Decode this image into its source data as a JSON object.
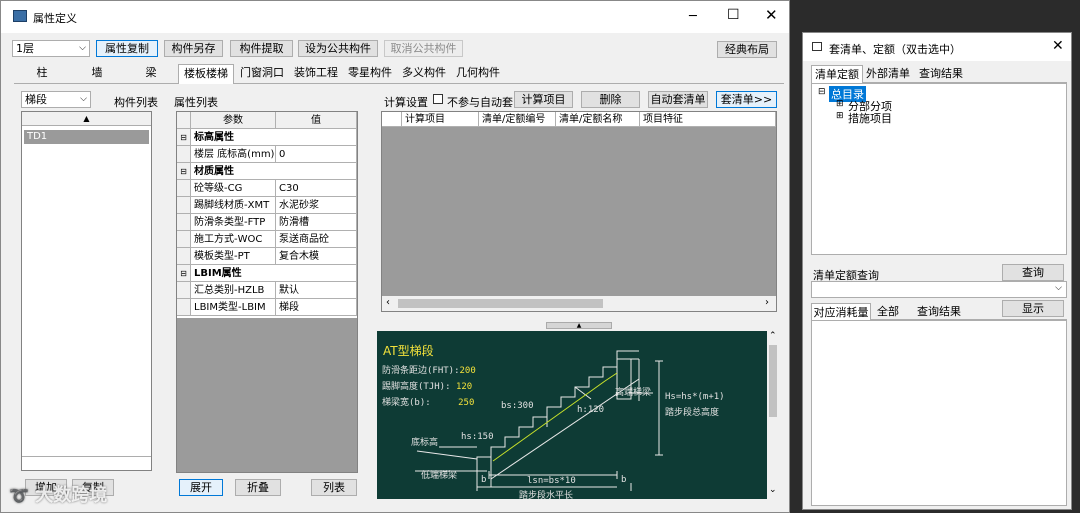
{
  "main_window": {
    "title": "属性定义",
    "floor_select": "1层",
    "toolbar": [
      "属性复制",
      "构件另存",
      "构件提取",
      "设为公共构件",
      "取消公共构件"
    ],
    "layout_button": "经典布局",
    "tabs": [
      "柱",
      "墙",
      "梁",
      "楼板楼梯",
      "门窗洞口",
      "装饰工程",
      "零星构件",
      "多义构件",
      "几何构件"
    ],
    "left": {
      "type_select": "梯段",
      "list_label": "构件列表",
      "items": [
        "TD1"
      ],
      "add_button": "增加",
      "copy_button": "复制"
    },
    "props": {
      "label": "属性列表",
      "col_param": "参数",
      "col_value": "值",
      "rows": [
        {
          "kind": "section",
          "name": "标高属性"
        },
        {
          "kind": "row",
          "name": "楼层 底标高(mm)",
          "value": "0"
        },
        {
          "kind": "section",
          "name": "材质属性"
        },
        {
          "kind": "row",
          "name": "砼等级-CG",
          "value": "C30"
        },
        {
          "kind": "row",
          "name": "踢脚线材质-XMT",
          "value": "水泥砂浆"
        },
        {
          "kind": "row",
          "name": "防滑条类型-FTP",
          "value": "防滑槽"
        },
        {
          "kind": "row",
          "name": "施工方式-WOC",
          "value": "泵送商品砼"
        },
        {
          "kind": "row",
          "name": "模板类型-PT",
          "value": "复合木模"
        },
        {
          "kind": "section",
          "name": "LBIM属性"
        },
        {
          "kind": "row",
          "name": "汇总类别-HZLB",
          "value": "默认"
        },
        {
          "kind": "row",
          "name": "LBIM类型-LBIM",
          "value": "梯段"
        }
      ],
      "expand_button": "展开",
      "collapse_button": "折叠",
      "list_button": "列表"
    },
    "calc": {
      "label": "计算设置",
      "checkbox_label": "不参与自动套",
      "buttons": [
        "计算项目",
        "删除",
        "自动套清单",
        "套清单>>"
      ],
      "columns": [
        "计算项目",
        "清单/定额编号",
        "清单/定额名称",
        "项目特征"
      ]
    },
    "diagram": {
      "title": "AT型梯段",
      "lines": [
        {
          "label": "防滑条距边(FHT):",
          "value": "200"
        },
        {
          "label": "踢脚高度(TJH):",
          "value": "120"
        },
        {
          "label": "梯梁宽(b):",
          "value": "250"
        }
      ],
      "bs": "bs:300",
      "h120": "h:120",
      "hs": "hs:150",
      "high_beam": "高端梯梁",
      "low_beam": "低端梯梁",
      "base_elev": "底标高",
      "formula_hs": "Hs=hs*(m+1)",
      "total_height": "踏步段总高度",
      "lsn": "lsn=bs*10",
      "horizontal": "踏步段水平长",
      "b": "b"
    }
  },
  "right_window": {
    "title": "套清单、定额（双击选中）",
    "tabs": [
      "清单定额",
      "外部清单",
      "查询结果"
    ],
    "tree": {
      "root": "总目录",
      "children": [
        "分部分项",
        "措施项目"
      ]
    },
    "query_label": "清单定额查询",
    "query_button": "查询",
    "bottom_tabs": [
      "对应消耗量",
      "全部",
      "查询结果"
    ],
    "show_button": "显示"
  },
  "watermark": "大数跨境",
  "colors": {
    "diagram_bg": "#0e3b35",
    "highlight": "#0078d7"
  }
}
